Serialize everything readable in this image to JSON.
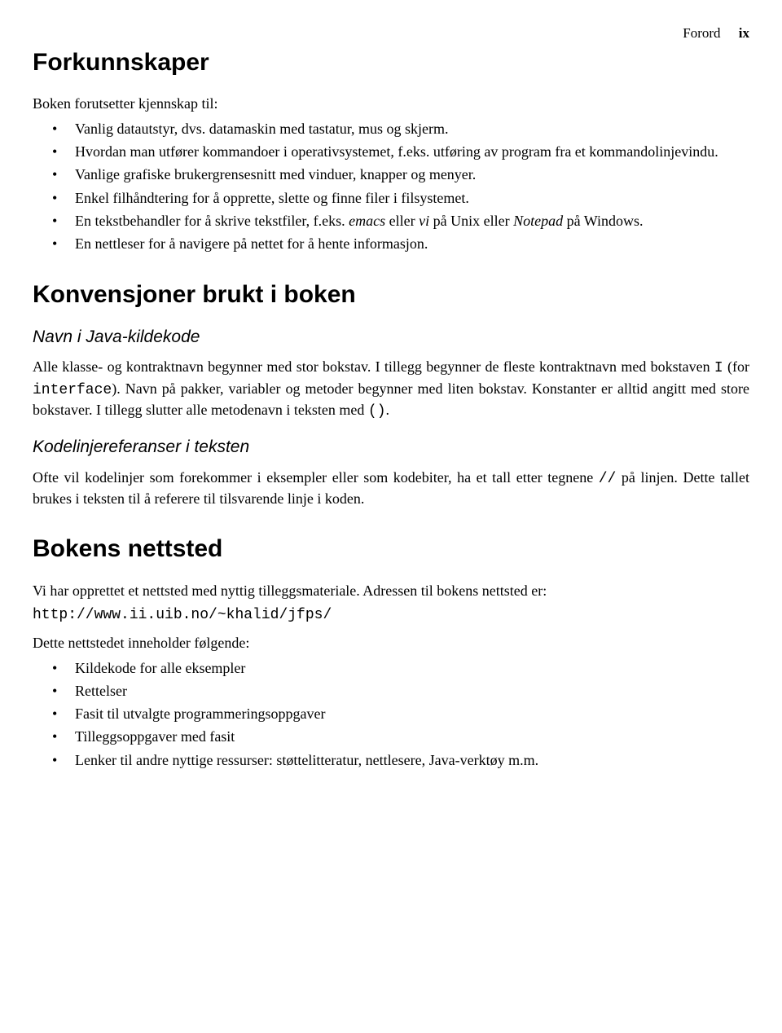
{
  "header": {
    "running": "Forord",
    "pagenum": "ix"
  },
  "sec1": {
    "title": "Forkunnskaper",
    "intro": "Boken forutsetter kjennskap til:",
    "items": [
      {
        "pre": "Vanlig datautstyr, dvs. datamaskin med tastatur, mus og skjerm."
      },
      {
        "pre": "Hvordan man utfører kommandoer i operativsystemet, f.eks. utføring av program fra et kommandolinjevindu."
      },
      {
        "pre": "Vanlige grafiske brukergrensesnitt med vinduer, knapper og menyer."
      },
      {
        "pre": "Enkel filhåndtering for å opprette, slette og finne filer i filsystemet."
      },
      {
        "pre": "En tekstbehandler for å skrive tekstfiler, f.eks. ",
        "em1": "emacs",
        "mid1": " eller ",
        "em2": "vi",
        "mid2": " på Unix eller ",
        "em3": "Notepad",
        "post": " på Windows."
      },
      {
        "pre": "En nettleser for å navigere på nettet for å hente informasjon."
      }
    ]
  },
  "sec2": {
    "title": "Konvensjoner brukt i boken",
    "sub1": {
      "heading": "Navn i Java-kildekode",
      "p": {
        "a": "Alle klasse- og kontraktnavn begynner med stor bokstav. I tillegg begynner de fleste kontraktnavn med bokstaven ",
        "tt1": "I",
        "b": " (for ",
        "tt2": "interface",
        "c": "). Navn på pakker, variabler og metoder begynner med liten bokstav. Konstanter er alltid angitt med store bokstaver. I tillegg slutter alle metodenavn i teksten med ",
        "tt3": "()",
        "d": "."
      }
    },
    "sub2": {
      "heading": "Kodelinjereferanser i teksten",
      "p": {
        "a": "Ofte vil kodelinjer som forekommer i eksempler eller som kodebiter, ha et tall etter tegnene ",
        "tt1": "//",
        "b": " på linjen. Dette tallet brukes i teksten til å referere til tilsvarende linje i koden."
      }
    }
  },
  "sec3": {
    "title": "Bokens nettsted",
    "intro": "Vi har opprettet et nettsted med nyttig tilleggsmateriale. Adressen til bokens nettsted er:",
    "url": "http://www.ii.uib.no/~khalid/jfps/",
    "lead": "Dette nettstedet inneholder følgende:",
    "items": [
      "Kildekode for alle eksempler",
      "Rettelser",
      "Fasit til utvalgte programmeringsoppgaver",
      "Tilleggsoppgaver med fasit",
      "Lenker til andre nyttige ressurser: støttelitteratur, nettlesere, Java-verktøy m.m."
    ]
  }
}
